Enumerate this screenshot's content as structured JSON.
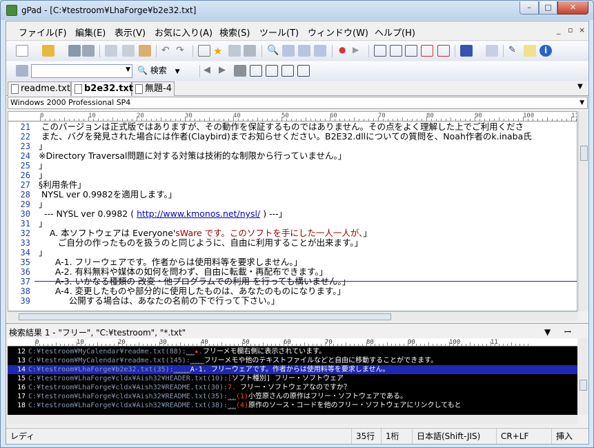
{
  "window": {
    "title": "gPad - [C:¥testroom¥LhaForge¥b2e32.txt]",
    "min": "–",
    "max": "□",
    "close": "✕"
  },
  "menu": {
    "items": [
      "ファイル(F)",
      "編集(E)",
      "表示(V)",
      "お気に入り(A)",
      "検索(S)",
      "ツール(T)",
      "ウィンドウ(W)",
      "ヘルプ(H)"
    ],
    "mdi_controls": [
      "_",
      "▫",
      "×"
    ]
  },
  "toolbar2": {
    "search_value": "",
    "search_label": "検索"
  },
  "tabs": [
    {
      "label": "readme.txt",
      "active": false
    },
    {
      "label": "b2e32.txt",
      "active": true
    },
    {
      "label": "無題-4",
      "active": false
    }
  ],
  "profile": {
    "selected": "Windows 2000 Professional SP4"
  },
  "ruler_labels": [
    "0",
    "10",
    "20",
    "30",
    "40",
    "50",
    "60",
    "70",
    "80",
    "90",
    "100",
    "11"
  ],
  "editor": {
    "lines": [
      {
        "n": "21",
        "t": " このバージョンは正式版ではありますが、その動作を保証するものではありません。その点をよく理解した上でご利用くださ"
      },
      {
        "n": "22",
        "t": " また、バグを発見された場合には作者(Claybird)までお知らせください。B2E32.dllについての質問を、Noah作者のk.inaba氏"
      },
      {
        "n": "23",
        "t": "」"
      },
      {
        "n": "24",
        "t": "※Directory Traversal問題に対する対策は技術的な制限から行っていません。」"
      },
      {
        "n": "25",
        "t": "」"
      },
      {
        "n": "26",
        "t": "」"
      },
      {
        "n": "27",
        "t": "§利用条件」"
      },
      {
        "n": "28",
        "t": " NYSL ver 0.9982を適用します。」"
      },
      {
        "n": "29",
        "t": "」"
      },
      {
        "n": "30",
        "t": "  --- NYSL ver 0.9982 ( ",
        "url": "http://www.kmonos.net/nysl/",
        "t2": " ) ---」"
      },
      {
        "n": "31",
        "t": "」"
      },
      {
        "n": "32",
        "t": "    A. 本ソフトウェアは Everyone'",
        "hl": "sWare です。このソフトを手にした一人一人が、",
        "t2": "」"
      },
      {
        "n": "33",
        "t": "       ご自分の作ったものを扱うのと同じように、自由に利用することが出来ます。」"
      },
      {
        "n": "34",
        "t": "」"
      },
      {
        "n": "35",
        "t": "      A-1. フリーウェアです。作者からは使用料等を要求しません。」"
      },
      {
        "n": "36",
        "t": "      A-2. 有料無料や媒体の如何を問わず、自由に転載・再配布できます。」"
      },
      {
        "n": "37",
        "t": "      A-3. いかなる種類の 改変・他プログラムでの利用 を行っても構いません。」"
      },
      {
        "n": "38",
        "t": "      A-4. 変更したものや部分的に使用したものは、あなたのものになります。」"
      },
      {
        "n": "39",
        "t": "           公開する場合は、あなたの名前の下で行って下さい。」"
      }
    ]
  },
  "results_panel": {
    "title": "検索結果 1 - \"フリー\", \"C:¥testroom\", \"*.txt\"",
    "controls": "▼ ꟷ ✕"
  },
  "results": [
    {
      "n": "12",
      "path": "C:¥testroom¥MyCalendar¥readme.txt(88):",
      "pre": "⎵⎵⎵",
      "m": "★.",
      "text": "フリーメモ欄右側に表示されています。",
      "sel": false
    },
    {
      "n": "13",
      "path": "C:¥testroom¥MyCalendar¥readme.txt(145):",
      "pre": "⎵⎵⎵⎵⎵",
      "m": "",
      "text": "フリーメモや他のテキストファイルなどと自由に移動することができます。",
      "sel": false
    },
    {
      "n": "14",
      "path": "C:¥testroom¥LhaForge¥b2e32.txt(35):",
      "pre": "⎵⎵⎵⎵⎵⎵",
      "m": "",
      "text": "A-1. フリーウェアです。作者からは使用料等を要求しません。",
      "sel": true
    },
    {
      "n": "15",
      "path": "C:¥testroom¥LhaForge¥cldx¥Aish32¥HEADER.txt(10):",
      "pre": "",
      "m": "[",
      "text": "ソフト種別] フリー・ソフトウェア",
      "sel": false
    },
    {
      "n": "16",
      "path": "C:¥testroom¥LhaForge¥cldx¥Aish32¥README.txt(30):",
      "pre": "",
      "m": "7.",
      "text": " フリー・ソフトウェアなのですか？",
      "sel": false
    },
    {
      "n": "17",
      "path": "C:¥testroom¥LhaForge¥cldx¥Aish32¥README.txt(35):",
      "pre": "⎵⎵⎵",
      "m": "(1)",
      "text": "小笠原さんの原作はフリー・ソフトウェアである。",
      "sel": false
    },
    {
      "n": "18",
      "path": "C:¥testroom¥LhaForge¥cldx¥Aish32¥README.txt(38):",
      "pre": "⎵⎵⎵",
      "m": "(4)",
      "text": "原作のソース・コードを他のフリー・ソフトウェアにリンクしてもと",
      "sel": false
    }
  ],
  "status": {
    "message": "レディ",
    "row": "35行",
    "col": "1桁",
    "encoding": "日本語(Shift-JIS)",
    "eol": "CR+LF",
    "mode": "挿入"
  },
  "colors": {
    "accent": "#1e28b4",
    "line_number": "#1a40b8",
    "highlight_text": "#a00000",
    "result_bg": "#000000"
  }
}
